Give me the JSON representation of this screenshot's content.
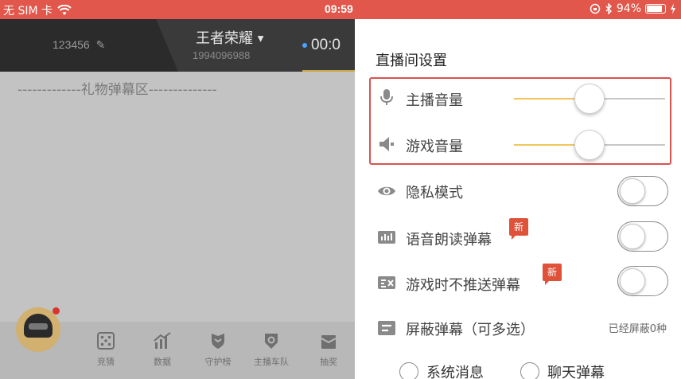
{
  "status_bar": {
    "carrier": "无 SIM 卡",
    "time": "09:59",
    "battery": "94%",
    "battery_level": 0.94,
    "icons": [
      "wifi-icon",
      "orientation-lock-icon",
      "bluetooth-icon",
      "battery-icon",
      "charging-icon"
    ]
  },
  "live_room": {
    "user_id": "123456",
    "game_name": "王者荣耀",
    "game_id": "1994096988",
    "timer": "00:0",
    "gift_area_label": "-------------礼物弹幕区--------------",
    "toolbar": [
      {
        "label": "竞猜",
        "icon": "dice-icon"
      },
      {
        "label": "数据",
        "icon": "chart-icon"
      },
      {
        "label": "守护榜",
        "icon": "shield-icon"
      },
      {
        "label": "主播车队",
        "icon": "team-badge-icon"
      },
      {
        "label": "抽奖",
        "icon": "gift-box-icon"
      }
    ]
  },
  "settings": {
    "title": "直播间设置",
    "anchor_volume": {
      "label": "主播音量",
      "value": 0.5
    },
    "game_volume": {
      "label": "游戏音量",
      "value": 0.5
    },
    "privacy_mode": {
      "label": "隐私模式",
      "on": false
    },
    "voice_read": {
      "label": "语音朗读弹幕",
      "badge": "新",
      "on": false
    },
    "no_push_in_game": {
      "label": "游戏时不推送弹幕",
      "badge": "新",
      "on": false
    },
    "block_danmaku": {
      "label": "屏蔽弹幕（可多选）",
      "status": "已经屏蔽0种"
    },
    "block_options": [
      {
        "label": "系统消息",
        "checked": false
      },
      {
        "label": "聊天弹幕",
        "checked": false
      }
    ]
  },
  "colors": {
    "accent": "#e2574c",
    "slider_fill": "#f0c75a",
    "highlight_border": "#d9534f",
    "topbar_bg": "#2b2b2b"
  }
}
